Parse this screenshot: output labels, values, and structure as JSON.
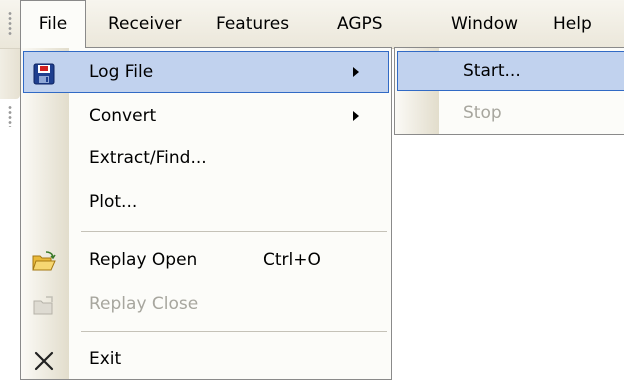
{
  "menubar": {
    "items": [
      {
        "label": "File"
      },
      {
        "label": "Receiver"
      },
      {
        "label": "Features"
      },
      {
        "label": "AGPS"
      },
      {
        "label": "Window"
      },
      {
        "label": "Help"
      }
    ]
  },
  "file_menu": {
    "items": [
      {
        "label": "Log File",
        "icon": "floppy-disk-icon",
        "submenu": true,
        "highlighted": true
      },
      {
        "label": "Convert",
        "submenu": true
      },
      {
        "label": "Extract/Find..."
      },
      {
        "label": "Plot..."
      },
      {
        "label": "Replay Open",
        "shortcut": "Ctrl+O",
        "icon": "open-folder-icon"
      },
      {
        "label": "Replay Close",
        "icon": "close-folder-icon",
        "disabled": true
      },
      {
        "label": "Exit",
        "icon": "close-x-icon"
      }
    ]
  },
  "log_file_submenu": {
    "items": [
      {
        "label": "Start...",
        "highlighted": true
      },
      {
        "label": "Stop",
        "disabled": true
      }
    ]
  },
  "colors": {
    "highlight_fill": "#c1d2ee",
    "highlight_border": "#316ac5",
    "disabled_text": "#a7a69e",
    "menu_background": "#fcfcf9"
  }
}
